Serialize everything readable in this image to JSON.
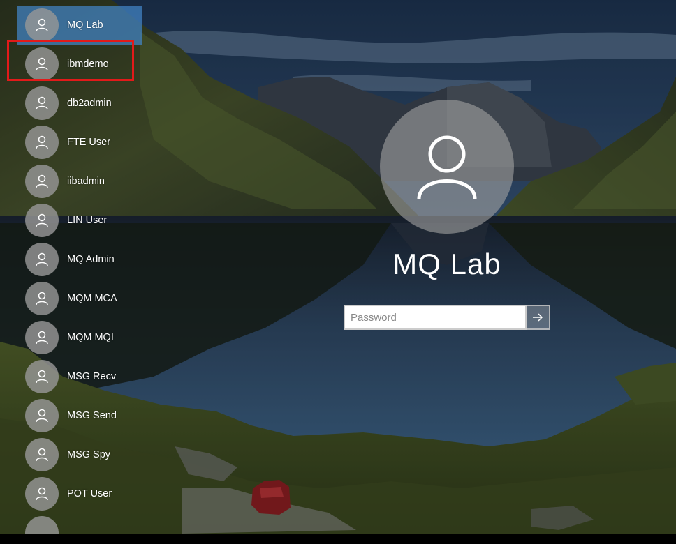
{
  "users": [
    {
      "name": "MQ Lab",
      "selected": true
    },
    {
      "name": "ibmdemo",
      "highlighted": true
    },
    {
      "name": "db2admin"
    },
    {
      "name": "FTE User"
    },
    {
      "name": "iibadmin"
    },
    {
      "name": "LIN User"
    },
    {
      "name": "MQ Admin"
    },
    {
      "name": "MQM MCA"
    },
    {
      "name": "MQM MQI"
    },
    {
      "name": "MSG Recv"
    },
    {
      "name": "MSG Send"
    },
    {
      "name": "MSG Spy"
    },
    {
      "name": "POT User"
    }
  ],
  "login": {
    "name": "MQ Lab",
    "password_placeholder": "Password",
    "password_value": ""
  },
  "icons": {
    "avatar": "user-icon",
    "submit": "arrow-right-icon"
  },
  "colors": {
    "selected_bg": "#4285c8",
    "highlight_border": "#e21a1a",
    "avatar_bg": "#969696"
  }
}
